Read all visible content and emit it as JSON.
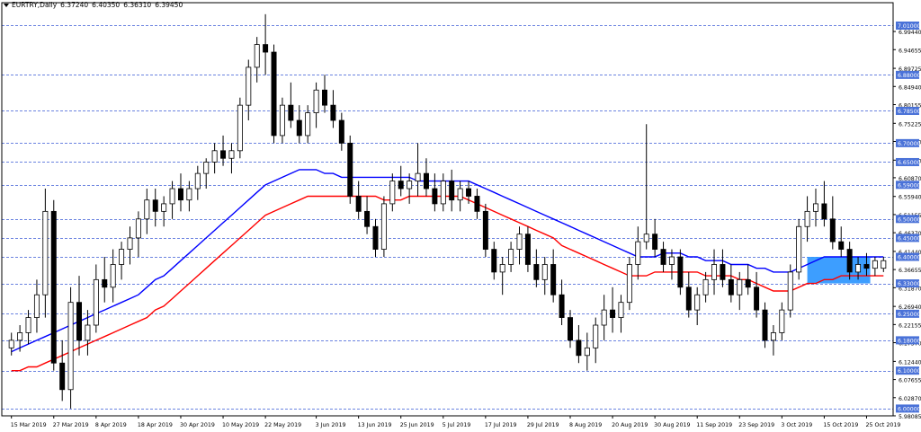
{
  "header": {
    "symbol": "EURTRY,Daily",
    "open": "6.37240",
    "high": "6.40350",
    "low": "6.36310",
    "close": "6.39450"
  },
  "chart_data": {
    "type": "candlestick",
    "instrument": "EURTRY",
    "timeframe": "Daily",
    "ylim": [
      5.9808,
      7.0372
    ],
    "y_ticks": [
      "6.99440",
      "6.94655",
      "6.89725",
      "6.84940",
      "6.80155",
      "6.75225",
      "6.70440",
      "6.65510",
      "6.60870",
      "6.55940",
      "6.51155",
      "6.46370",
      "6.41440",
      "6.36655",
      "6.31870",
      "6.26940",
      "6.22155",
      "6.17370",
      "6.12440",
      "6.07655",
      "6.02870",
      "5.98085"
    ],
    "level_lines": [
      {
        "value": 7.01,
        "label": "7.01000"
      },
      {
        "value": 6.88,
        "label": "6.88000"
      },
      {
        "value": 6.785,
        "label": "6.78500"
      },
      {
        "value": 6.7,
        "label": "6.70000"
      },
      {
        "value": 6.65,
        "label": "6.65000"
      },
      {
        "value": 6.59,
        "label": "6.59000"
      },
      {
        "value": 6.5,
        "label": "6.50000"
      },
      {
        "value": 6.45,
        "label": "6.45000"
      },
      {
        "value": 6.4,
        "label": "6.40000"
      },
      {
        "value": 6.33,
        "label": "6.33000"
      },
      {
        "value": 6.25,
        "label": "6.25000"
      },
      {
        "value": 6.18,
        "label": "6.18000"
      },
      {
        "value": 6.1,
        "label": "6.10000"
      },
      {
        "value": 6.0,
        "label": "6.00000"
      }
    ],
    "x_labels": [
      "15 Mar 2019",
      "27 Mar 2019",
      "8 Apr 2019",
      "18 Apr 2019",
      "30 Apr 2019",
      "10 May 2019",
      "22 May 2019",
      "3 Jun 2019",
      "13 Jun 2019",
      "25 Jun 2019",
      "5 Jul 2019",
      "17 Jul 2019",
      "29 Jul 2019",
      "8 Aug 2019",
      "20 Aug 2019",
      "30 Aug 2019",
      "11 Sep 2019",
      "23 Sep 2019",
      "3 Oct 2019",
      "15 Oct 2019",
      "25 Oct 2019"
    ],
    "candles": [
      [
        6.16,
        6.2,
        6.14,
        6.18
      ],
      [
        6.18,
        6.22,
        6.15,
        6.2
      ],
      [
        6.2,
        6.26,
        6.17,
        6.24
      ],
      [
        6.24,
        6.34,
        6.2,
        6.3
      ],
      [
        6.3,
        6.58,
        6.24,
        6.52
      ],
      [
        6.52,
        6.55,
        6.1,
        6.12
      ],
      [
        6.12,
        6.18,
        6.02,
        6.05
      ],
      [
        6.05,
        6.32,
        6.0,
        6.28
      ],
      [
        6.28,
        6.35,
        6.14,
        6.18
      ],
      [
        6.18,
        6.26,
        6.14,
        6.22
      ],
      [
        6.22,
        6.38,
        6.2,
        6.34
      ],
      [
        6.34,
        6.4,
        6.28,
        6.32
      ],
      [
        6.32,
        6.42,
        6.28,
        6.38
      ],
      [
        6.38,
        6.44,
        6.34,
        6.42
      ],
      [
        6.42,
        6.48,
        6.38,
        6.45
      ],
      [
        6.45,
        6.52,
        6.4,
        6.5
      ],
      [
        6.5,
        6.58,
        6.46,
        6.55
      ],
      [
        6.55,
        6.58,
        6.48,
        6.52
      ],
      [
        6.52,
        6.56,
        6.48,
        6.54
      ],
      [
        6.54,
        6.6,
        6.5,
        6.58
      ],
      [
        6.58,
        6.62,
        6.52,
        6.55
      ],
      [
        6.55,
        6.6,
        6.52,
        6.58
      ],
      [
        6.58,
        6.64,
        6.55,
        6.62
      ],
      [
        6.62,
        6.66,
        6.58,
        6.65
      ],
      [
        6.65,
        6.7,
        6.62,
        6.68
      ],
      [
        6.68,
        6.72,
        6.64,
        6.66
      ],
      [
        6.66,
        6.7,
        6.62,
        6.68
      ],
      [
        6.68,
        6.82,
        6.66,
        6.8
      ],
      [
        6.8,
        6.92,
        6.76,
        6.9
      ],
      [
        6.9,
        6.98,
        6.86,
        6.96
      ],
      [
        6.96,
        7.04,
        6.88,
        6.94
      ],
      [
        6.94,
        6.96,
        6.7,
        6.72
      ],
      [
        6.72,
        6.82,
        6.7,
        6.8
      ],
      [
        6.8,
        6.86,
        6.74,
        6.76
      ],
      [
        6.76,
        6.8,
        6.7,
        6.72
      ],
      [
        6.72,
        6.8,
        6.7,
        6.78
      ],
      [
        6.78,
        6.86,
        6.74,
        6.84
      ],
      [
        6.84,
        6.88,
        6.78,
        6.8
      ],
      [
        6.8,
        6.84,
        6.74,
        6.76
      ],
      [
        6.76,
        6.78,
        6.68,
        6.7
      ],
      [
        6.7,
        6.72,
        6.54,
        6.56
      ],
      [
        6.56,
        6.6,
        6.5,
        6.52
      ],
      [
        6.52,
        6.56,
        6.46,
        6.48
      ],
      [
        6.48,
        6.5,
        6.4,
        6.42
      ],
      [
        6.42,
        6.56,
        6.4,
        6.54
      ],
      [
        6.54,
        6.62,
        6.52,
        6.6
      ],
      [
        6.6,
        6.64,
        6.56,
        6.58
      ],
      [
        6.58,
        6.62,
        6.54,
        6.6
      ],
      [
        6.6,
        6.7,
        6.56,
        6.62
      ],
      [
        6.62,
        6.66,
        6.56,
        6.58
      ],
      [
        6.58,
        6.62,
        6.52,
        6.54
      ],
      [
        6.54,
        6.62,
        6.52,
        6.6
      ],
      [
        6.6,
        6.63,
        6.52,
        6.55
      ],
      [
        6.55,
        6.6,
        6.52,
        6.58
      ],
      [
        6.58,
        6.6,
        6.54,
        6.56
      ],
      [
        6.56,
        6.58,
        6.5,
        6.52
      ],
      [
        6.52,
        6.54,
        6.4,
        6.42
      ],
      [
        6.42,
        6.44,
        6.34,
        6.36
      ],
      [
        6.36,
        6.4,
        6.3,
        6.38
      ],
      [
        6.38,
        6.44,
        6.36,
        6.42
      ],
      [
        6.42,
        6.48,
        6.38,
        6.46
      ],
      [
        6.46,
        6.48,
        6.36,
        6.38
      ],
      [
        6.38,
        6.42,
        6.32,
        6.34
      ],
      [
        6.34,
        6.4,
        6.3,
        6.38
      ],
      [
        6.38,
        6.42,
        6.28,
        6.3
      ],
      [
        6.3,
        6.34,
        6.22,
        6.24
      ],
      [
        6.24,
        6.26,
        6.16,
        6.18
      ],
      [
        6.18,
        6.22,
        6.12,
        6.14
      ],
      [
        6.14,
        6.2,
        6.1,
        6.16
      ],
      [
        6.16,
        6.24,
        6.12,
        6.22
      ],
      [
        6.22,
        6.3,
        6.18,
        6.26
      ],
      [
        6.26,
        6.32,
        6.2,
        6.24
      ],
      [
        6.24,
        6.3,
        6.2,
        6.28
      ],
      [
        6.28,
        6.4,
        6.26,
        6.38
      ],
      [
        6.38,
        6.48,
        6.34,
        6.44
      ],
      [
        6.44,
        6.75,
        6.42,
        6.46
      ],
      [
        6.46,
        6.5,
        6.4,
        6.42
      ],
      [
        6.42,
        6.44,
        6.36,
        6.38
      ],
      [
        6.38,
        6.42,
        6.34,
        6.4
      ],
      [
        6.4,
        6.42,
        6.3,
        6.32
      ],
      [
        6.32,
        6.36,
        6.24,
        6.26
      ],
      [
        6.26,
        6.32,
        6.22,
        6.3
      ],
      [
        6.3,
        6.36,
        6.28,
        6.34
      ],
      [
        6.34,
        6.42,
        6.3,
        6.38
      ],
      [
        6.38,
        6.42,
        6.32,
        6.34
      ],
      [
        6.34,
        6.38,
        6.28,
        6.3
      ],
      [
        6.3,
        6.36,
        6.26,
        6.34
      ],
      [
        6.34,
        6.38,
        6.3,
        6.32
      ],
      [
        6.32,
        6.36,
        6.24,
        6.26
      ],
      [
        6.26,
        6.28,
        6.16,
        6.18
      ],
      [
        6.18,
        6.22,
        6.14,
        6.2
      ],
      [
        6.2,
        6.28,
        6.18,
        6.26
      ],
      [
        6.26,
        6.38,
        6.24,
        6.36
      ],
      [
        6.36,
        6.5,
        6.34,
        6.48
      ],
      [
        6.48,
        6.56,
        6.44,
        6.52
      ],
      [
        6.52,
        6.58,
        6.48,
        6.54
      ],
      [
        6.54,
        6.6,
        6.48,
        6.5
      ],
      [
        6.5,
        6.56,
        6.42,
        6.44
      ],
      [
        6.44,
        6.48,
        6.4,
        6.42
      ],
      [
        6.42,
        6.44,
        6.34,
        6.36
      ],
      [
        6.36,
        6.4,
        6.34,
        6.38
      ],
      [
        6.38,
        6.41,
        6.35,
        6.37
      ],
      [
        6.37,
        6.4,
        6.35,
        6.39
      ],
      [
        6.37,
        6.4,
        6.36,
        6.39
      ]
    ],
    "series": [
      {
        "name": "",
        "type": "line",
        "color": "#0000ff",
        "values": [
          6.15,
          6.16,
          6.17,
          6.18,
          6.19,
          6.2,
          6.21,
          6.22,
          6.23,
          6.24,
          6.25,
          6.26,
          6.27,
          6.28,
          6.29,
          6.3,
          6.32,
          6.34,
          6.35,
          6.37,
          6.39,
          6.41,
          6.43,
          6.45,
          6.47,
          6.49,
          6.51,
          6.53,
          6.55,
          6.57,
          6.59,
          6.6,
          6.61,
          6.62,
          6.63,
          6.63,
          6.63,
          6.62,
          6.62,
          6.61,
          6.61,
          6.61,
          6.61,
          6.61,
          6.61,
          6.61,
          6.61,
          6.61,
          6.6,
          6.6,
          6.6,
          6.6,
          6.6,
          6.6,
          6.6,
          6.59,
          6.58,
          6.57,
          6.56,
          6.55,
          6.54,
          6.53,
          6.52,
          6.51,
          6.5,
          6.49,
          6.48,
          6.47,
          6.46,
          6.45,
          6.44,
          6.43,
          6.42,
          6.41,
          6.4,
          6.4,
          6.4,
          6.41,
          6.41,
          6.41,
          6.4,
          6.4,
          6.39,
          6.39,
          6.39,
          6.38,
          6.38,
          6.38,
          6.37,
          6.37,
          6.36,
          6.36,
          6.36,
          6.37,
          6.38,
          6.39,
          6.4,
          6.4,
          6.4,
          6.4,
          6.4,
          6.4,
          6.4,
          6.4
        ]
      },
      {
        "name": "",
        "type": "line",
        "color": "#ff0000",
        "values": [
          6.1,
          6.1,
          6.11,
          6.11,
          6.12,
          6.13,
          6.14,
          6.15,
          6.16,
          6.17,
          6.18,
          6.19,
          6.2,
          6.21,
          6.22,
          6.23,
          6.24,
          6.26,
          6.27,
          6.29,
          6.31,
          6.33,
          6.35,
          6.37,
          6.39,
          6.41,
          6.43,
          6.45,
          6.47,
          6.49,
          6.51,
          6.52,
          6.53,
          6.54,
          6.55,
          6.56,
          6.56,
          6.56,
          6.56,
          6.56,
          6.56,
          6.56,
          6.56,
          6.56,
          6.55,
          6.55,
          6.55,
          6.56,
          6.56,
          6.56,
          6.56,
          6.56,
          6.56,
          6.56,
          6.55,
          6.54,
          6.53,
          6.52,
          6.51,
          6.5,
          6.49,
          6.48,
          6.47,
          6.46,
          6.45,
          6.43,
          6.42,
          6.41,
          6.4,
          6.39,
          6.38,
          6.37,
          6.36,
          6.35,
          6.35,
          6.35,
          6.36,
          6.36,
          6.36,
          6.36,
          6.36,
          6.36,
          6.35,
          6.35,
          6.35,
          6.35,
          6.34,
          6.34,
          6.33,
          6.32,
          6.31,
          6.31,
          6.31,
          6.32,
          6.33,
          6.33,
          6.34,
          6.34,
          6.35,
          6.35,
          6.35,
          6.35,
          6.35,
          6.35
        ]
      }
    ],
    "highlight_box": {
      "from": 6.33,
      "to": 6.4,
      "color": "#3399ff"
    },
    "grid": false,
    "bull_color": "#ffffff",
    "bear_color": "#000000"
  }
}
